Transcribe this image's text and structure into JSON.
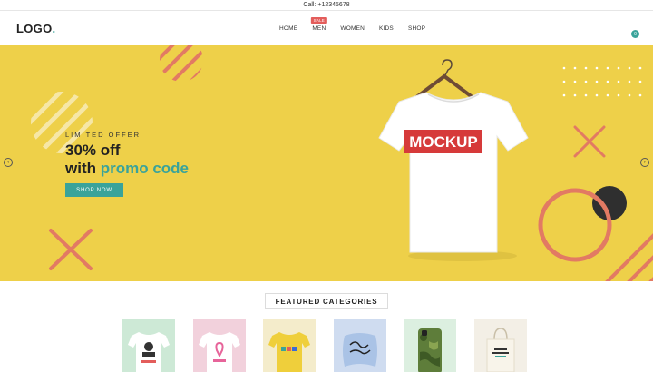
{
  "topbar": {
    "call_text": "Call: +12345678"
  },
  "header": {
    "logo_text": "LOGO",
    "logo_dot": ".",
    "nav": [
      {
        "label": "HOME"
      },
      {
        "label": "MEN",
        "badge": "SALE"
      },
      {
        "label": "WOMEN"
      },
      {
        "label": "KIDS"
      },
      {
        "label": "SHOP"
      }
    ],
    "cart_count": "0"
  },
  "hero": {
    "kicker": "LIMITED OFFER",
    "line1": "30% off",
    "line2_prefix": "with ",
    "line2_highlight": "promo code",
    "cta_label": "SHOP NOW",
    "product_text": "MOCKUP",
    "prev_icon": "chevron-left-icon",
    "next_icon": "chevron-right-icon"
  },
  "featured": {
    "title": "FEATURED CATEGORIES",
    "categories": [
      {
        "name": "tshirt-print",
        "bg": "#cde9d6"
      },
      {
        "name": "ribbon-tee",
        "bg": "#f2d1dc"
      },
      {
        "name": "yellow-tee",
        "bg": "#f4eccb"
      },
      {
        "name": "pillow",
        "bg": "#cfdcf0"
      },
      {
        "name": "phone-case",
        "bg": "#dcefe0"
      },
      {
        "name": "tote-bag",
        "bg": "#f3efe6"
      }
    ]
  },
  "colors": {
    "accent": "#3aa39a",
    "hero_bg": "#eed049",
    "coral": "#e27a63",
    "sale": "#e35d5b"
  }
}
